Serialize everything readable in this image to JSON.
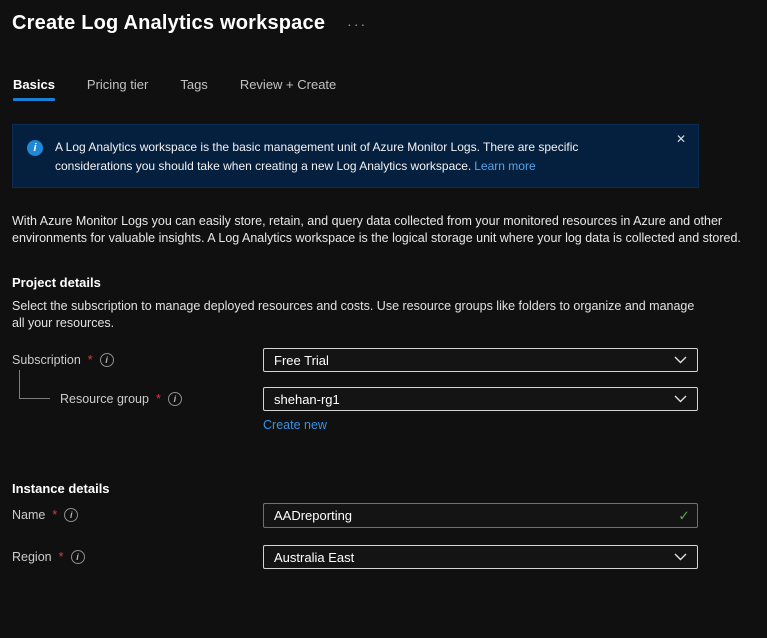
{
  "header": {
    "title": "Create Log Analytics workspace",
    "more_options": "···"
  },
  "tabs": {
    "items": [
      {
        "label": "Basics",
        "active": true
      },
      {
        "label": "Pricing tier",
        "active": false
      },
      {
        "label": "Tags",
        "active": false
      },
      {
        "label": "Review + Create",
        "active": false
      }
    ]
  },
  "banner": {
    "info_glyph": "i",
    "message": "A Log Analytics workspace is the basic management unit of Azure Monitor Logs. There are specific considerations you should take when creating a new Log Analytics workspace.",
    "link_label": "Learn more",
    "close_glyph": "✕"
  },
  "intro_text": "With Azure Monitor Logs you can easily store, retain, and query data collected from your monitored resources in Azure and other environments for valuable insights. A Log Analytics workspace is the logical storage unit where your log data is collected and stored.",
  "project_details": {
    "heading": "Project details",
    "description": "Select the subscription to manage deployed resources and costs. Use resource groups like folders to organize and manage all your resources.",
    "subscription": {
      "label": "Subscription",
      "required_marker": "*",
      "info_glyph": "i",
      "value": "Free Trial"
    },
    "resource_group": {
      "label": "Resource group",
      "required_marker": "*",
      "info_glyph": "i",
      "value": "shehan-rg1",
      "create_new_label": "Create new"
    }
  },
  "instance_details": {
    "heading": "Instance details",
    "name": {
      "label": "Name",
      "required_marker": "*",
      "info_glyph": "i",
      "value": "AADreporting",
      "valid_glyph": "✓"
    },
    "region": {
      "label": "Region",
      "required_marker": "*",
      "info_glyph": "i",
      "value": "Australia East"
    }
  },
  "colors": {
    "background": "#101010",
    "banner_background": "#05203f",
    "accent_blue": "#1b7fd4",
    "link_blue": "#59a4e8",
    "create_new_blue": "#3493e6",
    "required_red": "#cf4040",
    "valid_green": "#5aa348",
    "focus_purple": "#8f4fbf",
    "info_icon_blue": "#1e87d6"
  }
}
